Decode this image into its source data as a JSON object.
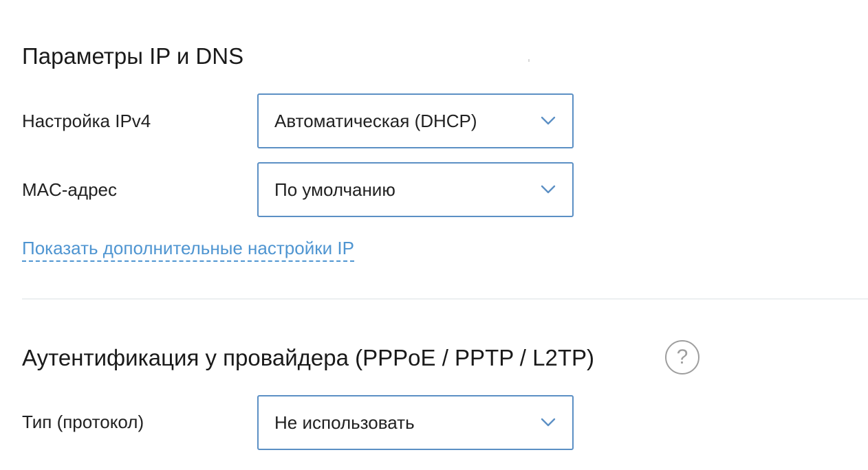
{
  "ip_dns": {
    "title": "Параметры IP и DNS",
    "ipv4": {
      "label": "Настройка IPv4",
      "value": "Автоматическая (DHCP)"
    },
    "mac": {
      "label": "MAC-адрес",
      "value": "По умолчанию"
    },
    "more_link": "Показать дополнительные настройки IP"
  },
  "auth": {
    "title": "Аутентификация у провайдера (PPPoE / PPTP / L2TP)",
    "help_glyph": "?",
    "type": {
      "label": "Тип (протокол)",
      "value": "Не использовать"
    }
  },
  "icons": {
    "dropdown": "chevron-down-icon",
    "help": "question-circle-icon"
  },
  "colors": {
    "accent": "#4f95d1",
    "select_border": "#5b8fc4",
    "text": "#212121",
    "muted": "#9e9e9e",
    "divider": "#eceff1"
  }
}
